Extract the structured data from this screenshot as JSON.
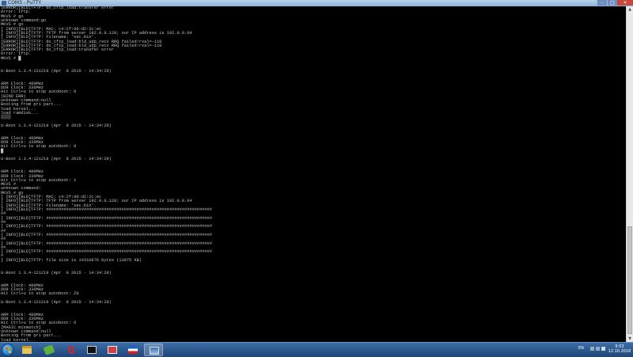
{
  "window": {
    "title": "COM3 - PuTTY",
    "controls": [
      "minimize",
      "maximize",
      "close"
    ]
  },
  "terminal": {
    "lines": [
      "[ERROR][BLD]TFTP: do_tftp_load:transfer error",
      "error: tftp.",
      "MKVS # go",
      "unknown command:go",
      "MKVS # go",
      "[ INFO][BLD]TFTP: MAC: c4:2f:90:d2:2c:ec",
      "[ INFO][BLD]TFTP: TFTP from server 192.0.0.128; our IP address is 192.0.0.64",
      "[ INFO][BLD]TFTP: Filename: 'sec.bin'.",
      "[ERROR][BLD]TFTP: do_tftp_load:bld_udp_recv RRQ failed!rval=-110",
      "[ERROR][BLD]TFTP: do_tftp_load:bld_udp_recv RRQ failed!rval=-110",
      "[ERROR][BLD]TFTP: do_tftp_load:transfer error",
      "error: tftp.",
      "MKVS # █",
      "",
      "",
      "U-Boot 1.3.4-121219 (Apr  8 2015 - 14:34:29)",
      "",
      "",
      "ARM Clock: 480MHz",
      "DDR Clock: 336MHz",
      "Hit Ctrl+u to stop autoboot: 0",
      "(BIND ERR)",
      "unknown command:null",
      "Booting from pri part...",
      "load kernel...",
      "load ramdisk...",
      "▒▒▒▒",
      "",
      "U-Boot 1.3.4-121219 (Apr  8 2015 - 14:34:29)",
      "",
      "",
      "ARM Clock: 480MHz",
      "DDR Clock: 336MHz",
      "Hit Ctrl+u to stop autoboot: 0",
      "█",
      "",
      "U-Boot 1.3.4-121219 (Apr  8 2015 - 14:34:29)",
      "",
      "",
      "ARM Clock: 480MHz",
      "DDR Clock: 336MHz",
      "Hit Ctrl+u to stop autoboot: 1",
      "MKVS #",
      "unknown command:",
      "MKVS # go",
      "[ INFO][BLD]TFTP: MAC: c4:2f:90:d2:2c:ec",
      "[ INFO][BLD]TFTP: TFTP from server 192.0.0.128; our IP address is 192.0.0.64",
      "[ INFO][BLD]TFTP: Filename: 'sec.bin'.",
      "[ INFO][BLD]TFTP: ##################################################################",
      "##",
      "[ INFO][BLD]TFTP: ##################################################################",
      "##",
      "[ INFO][BLD]TFTP: ##################################################################",
      "##",
      "[ INFO][BLD]TFTP: ##################################################################",
      "##",
      "[ INFO][BLD]TFTP: ##################################################################",
      "##",
      "[ INFO][BLD]TFTP: ##################################################################",
      "#",
      "[ INFO][BLD]TFTP: file size is 14310876 bytes (13975 KB)",
      "",
      "",
      "U-Boot 1.3.4-121219 (Apr  8 2015 - 14:34:29)",
      "",
      "",
      "ARM Clock: 480MHz",
      "DDR Clock: 336MHz",
      "Hit Ctrl+u to stop autoboot: Z0",
      "",
      "U-Boot 1.3.4-121219 (Apr  8 2015 - 14:34:29)",
      "",
      "",
      "ARM Clock: 480MHz",
      "DDR Clock: 336MHz",
      "Hit Ctrl+u to stop autoboot: 0",
      "[MAGIC mismatch]",
      "unknown command:null",
      "Booting from pri part...",
      "load kernel...",
      "load ramdisk...",
      "█"
    ]
  },
  "taskbar": {
    "apps": [
      {
        "name": "Windows Explorer",
        "icon": "folder-icon",
        "active": false
      },
      {
        "name": "App",
        "icon": "green-leaf-icon",
        "active": false
      },
      {
        "name": "Opera",
        "icon": "opera-icon",
        "active": false
      },
      {
        "name": "Command Prompt",
        "icon": "console-icon",
        "active": false
      },
      {
        "name": "Network",
        "icon": "network-manager-icon",
        "active": false
      },
      {
        "name": "Tool",
        "icon": "flag-tool-icon",
        "active": false
      },
      {
        "name": "PuTTY",
        "icon": "putty-icon",
        "active": true
      }
    ],
    "language": "EN",
    "time": "9:53",
    "date": "12.10.2016"
  },
  "colors": {
    "terminal_bg": "#000000",
    "terminal_fg": "#c0c0c0",
    "taskbar": "#1f4577",
    "close_button": "#c8463a"
  }
}
